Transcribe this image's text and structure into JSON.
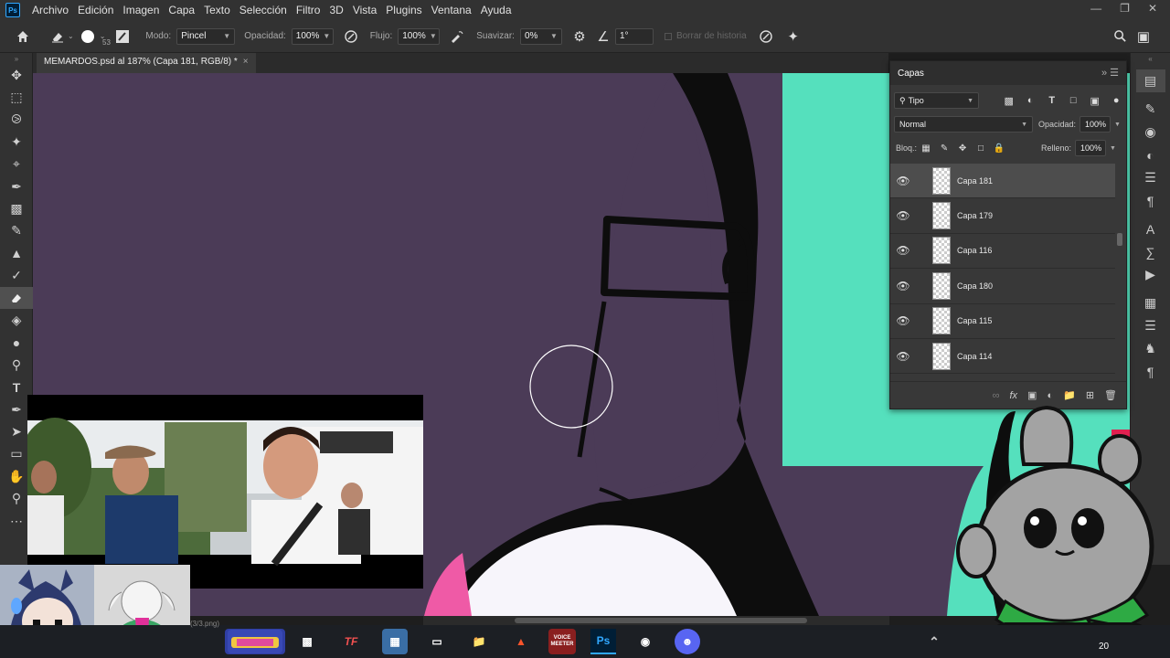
{
  "menubar": {
    "logo": "Ps",
    "items": [
      "Archivo",
      "Edición",
      "Imagen",
      "Capa",
      "Texto",
      "Selección",
      "Filtro",
      "3D",
      "Vista",
      "Plugins",
      "Ventana",
      "Ayuda"
    ]
  },
  "options": {
    "brush_size": "53",
    "mode_label": "Modo:",
    "mode_value": "Pincel",
    "opacity_label": "Opacidad:",
    "opacity_value": "100%",
    "flow_label": "Flujo:",
    "flow_value": "100%",
    "smoothing_label": "Suavizar:",
    "smoothing_value": "0%",
    "angle_value": "1°",
    "history_label": "Borrar de historia"
  },
  "document": {
    "tab_title": "MEMARDOS.psd al 187% (Capa 181, RGB/8) *",
    "canvas_colors": {
      "background": "#4b3b57",
      "teal": "#55e0bd",
      "lines": "#0d0d0d"
    }
  },
  "layers_panel": {
    "title": "Capas",
    "filter_label": "Tipo",
    "blend_mode": "Normal",
    "opacity_label": "Opacidad:",
    "opacity_value": "100%",
    "lock_label": "Bloq.:",
    "fill_label": "Relleno:",
    "fill_value": "100%",
    "layers": [
      {
        "name": "Capa 181",
        "selected": true
      },
      {
        "name": "Capa 179",
        "selected": false
      },
      {
        "name": "Capa 116",
        "selected": false
      },
      {
        "name": "Capa 180",
        "selected": false
      },
      {
        "name": "Capa 115",
        "selected": false
      },
      {
        "name": "Capa 114",
        "selected": false
      }
    ]
  },
  "taskbar": {
    "apps": [
      "TF",
      "VOICE MEETER",
      "Ps"
    ],
    "status_text": "(3/3.png)",
    "clock_fragment": "20"
  }
}
